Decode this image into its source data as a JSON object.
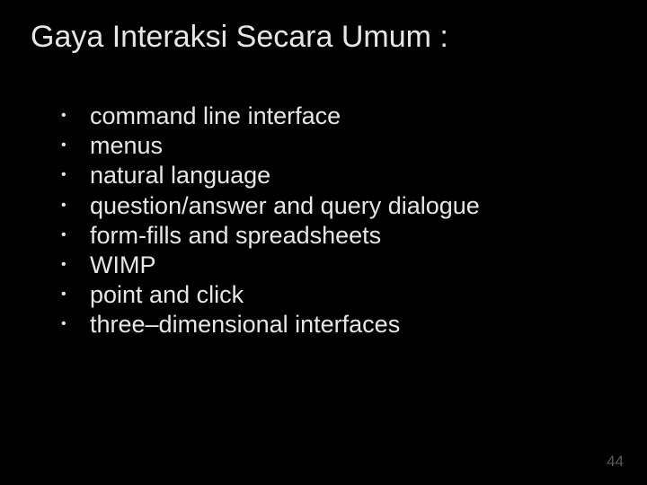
{
  "title": "Gaya Interaksi Secara Umum :",
  "bullets": [
    "command line interface",
    "menus",
    "natural language",
    "question/answer and query dialogue",
    "form-fills and spreadsheets",
    "WIMP",
    "point and click",
    "three–dimensional interfaces"
  ],
  "page_number": "44"
}
